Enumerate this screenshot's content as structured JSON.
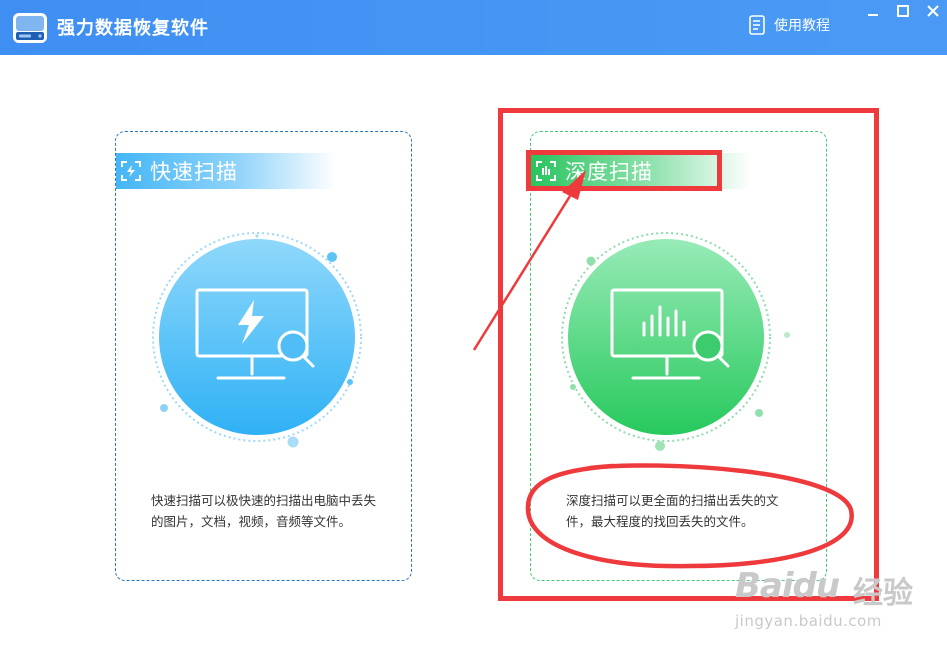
{
  "window": {
    "title": "强力数据恢复软件",
    "help_label": "使用教程",
    "app_icon": "hard-drive-icon",
    "accent": "#4495f4"
  },
  "cards": [
    {
      "id": "quick",
      "title": "快速扫描",
      "description": "快速扫描可以极快速的扫描出电脑中丢失的图片，文档，视频，音频等文件。",
      "icon": "lightning-icon",
      "color": "#3fb3f6"
    },
    {
      "id": "deep",
      "title": "深度扫描",
      "description": "深度扫描可以更全面的扫描出丢失的文件，最大程度的找回丢失的文件。",
      "icon": "bar-chart-icon",
      "color": "#2ccb61"
    }
  ],
  "watermark": {
    "brand": "Baidu",
    "brand_suffix": "经验",
    "url": "jingyan.baidu.com"
  },
  "annotation_color": "#ee3a3c"
}
